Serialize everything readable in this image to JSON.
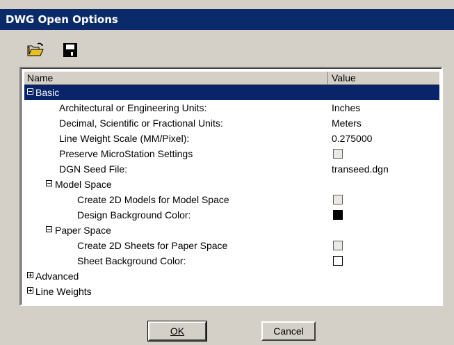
{
  "window": {
    "title": "DWG Open Options"
  },
  "toolbar": {
    "open_icon": "folder-open-icon",
    "save_icon": "floppy-disk-icon"
  },
  "columns": {
    "name": "Name",
    "value": "Value"
  },
  "rows": [
    {
      "label": "Basic",
      "type": "group-expanded"
    },
    {
      "label": "Architectural or Engineering Units:",
      "value": "Inches"
    },
    {
      "label": "Decimal, Scientific or Fractional Units:",
      "value": "Meters"
    },
    {
      "label": "Line Weight Scale (MM/Pixel):",
      "value": "0.275000"
    },
    {
      "label": "Preserve MicroStation Settings",
      "value": ""
    },
    {
      "label": "DGN Seed File:",
      "value": "transeed.dgn"
    },
    {
      "label": "Model Space",
      "type": "group-expanded"
    },
    {
      "label": "Create 2D Models for Model Space",
      "value": ""
    },
    {
      "label": "Design Background Color:",
      "color": "#000000"
    },
    {
      "label": "Paper Space",
      "type": "group-expanded"
    },
    {
      "label": "Create 2D Sheets for Paper Space",
      "value": ""
    },
    {
      "label": "Sheet Background Color:",
      "color": "#ffffff"
    },
    {
      "label": "Advanced",
      "type": "group-collapsed"
    },
    {
      "label": "Line Weights",
      "type": "group-collapsed"
    }
  ],
  "buttons": {
    "ok_label": "OK",
    "cancel_label": "Cancel"
  },
  "colors": {
    "titlebar": "#0a2a6a",
    "selection": "#0a246a",
    "face": "#d4d0c8"
  }
}
